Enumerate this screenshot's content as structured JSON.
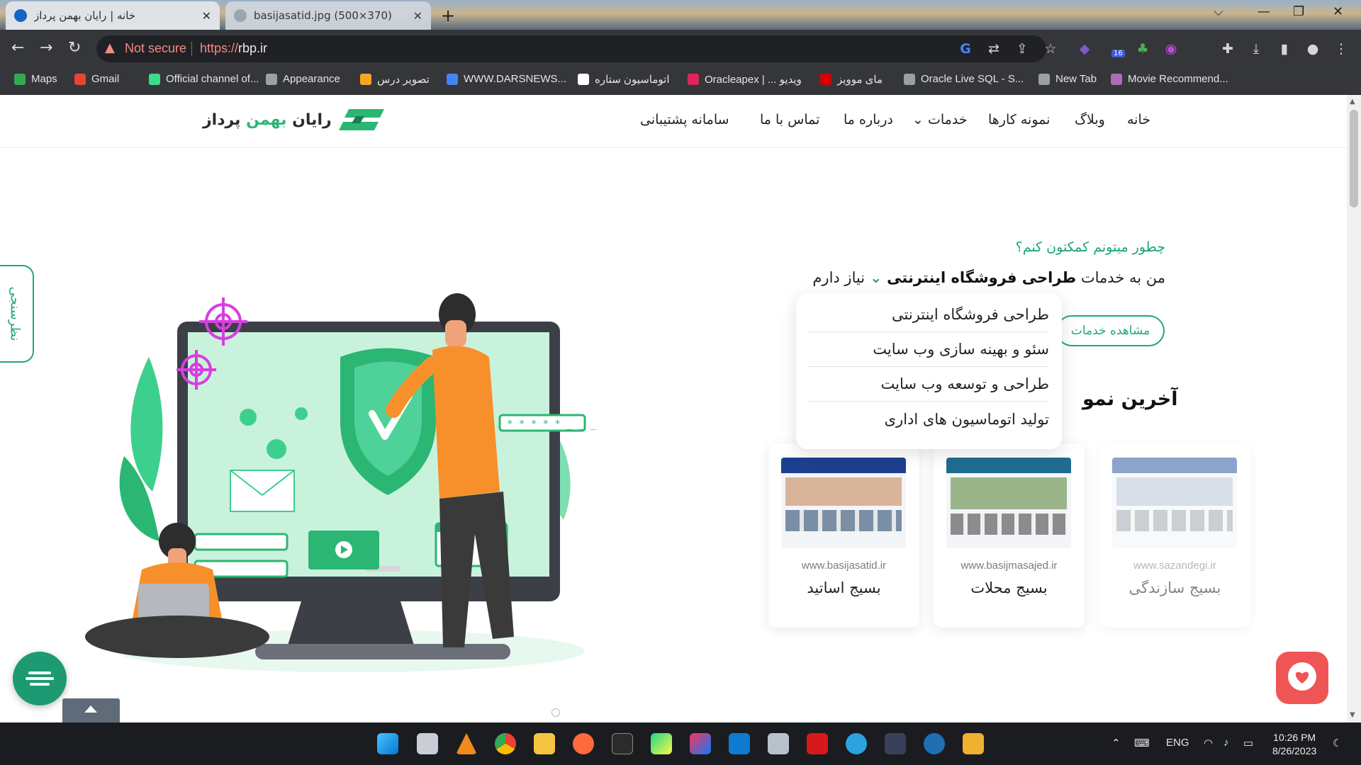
{
  "browser": {
    "tabs": [
      {
        "title": "خانه | رایان بهمن پرداز",
        "active": true
      },
      {
        "title": "basijasatid.jpg (500×370)",
        "active": false
      }
    ],
    "new_tab": "+",
    "window_controls": {
      "chevron": "⌵",
      "minimize": "—",
      "restore": "❐",
      "close": "✕"
    },
    "nav": {
      "back": "←",
      "forward": "→",
      "reload": "↻"
    },
    "address": {
      "warning": "Not secure",
      "scheme": "https://",
      "host": "rbp.ir"
    },
    "toolbar_icons": [
      "google-icon",
      "translate-icon",
      "share-icon",
      "star-icon",
      "extension-icon",
      "download-icon",
      "sidepanel-icon",
      "profile-icon",
      "menu-icon"
    ],
    "extension_badge": "16",
    "bookmarks": [
      {
        "label": "Maps",
        "color": "#34a853"
      },
      {
        "label": "Gmail",
        "color": "#ea4335"
      },
      {
        "label": "Official channel of...",
        "color": "#3ddc84"
      },
      {
        "label": "Appearance",
        "color": "#9aa0a6"
      },
      {
        "label": "تصویر درس",
        "color": "#f6a623"
      },
      {
        "label": "WWW.DARSNEWS...",
        "color": "#4285f4"
      },
      {
        "label": "اتوماسیون ستاره",
        "color": "#ffffff"
      },
      {
        "label": "Oracleapex | ... ویدیو",
        "color": "#e0245e"
      },
      {
        "label": "مای موویز",
        "color": "#d50000"
      },
      {
        "label": "Oracle Live SQL - S...",
        "color": "#9aa0a6"
      },
      {
        "label": "New Tab",
        "color": "#9aa0a6"
      },
      {
        "label": "Movie Recommend...",
        "color": "#b06ab3"
      }
    ]
  },
  "site": {
    "logo": {
      "text_dark": "رایان",
      "text_green": "بهمن",
      "text_dark2": "پرداز"
    },
    "nav": [
      "خانه",
      "وبلاگ",
      "نمونه کارها",
      "خدمات",
      "درباره ما",
      "تماس با ما",
      "سامانه پشتیبانی"
    ],
    "hero": {
      "question": "چطور میتونم کمکتون کنم؟",
      "prefix": "من به خدمات",
      "selected": "طراحی فروشگاه اینترنتی",
      "suffix": "نیاز دارم",
      "cta": "مشاهده خدمات",
      "section_title": "آخرین نمو"
    },
    "dropdown": [
      "طراحی فروشگاه اینترنتی",
      "سئو و بهینه سازی وب سایت",
      "طراحی و توسعه وب سایت",
      "تولید اتوماسیون های اداری"
    ],
    "portfolio": [
      {
        "url": "www.basijasatid.ir",
        "name": "بسیج اساتید"
      },
      {
        "url": "www.basijmasajed.ir",
        "name": "بسیج محلات"
      },
      {
        "url": "www.sazandegi.ir",
        "name": "بسیج سازندگی"
      }
    ],
    "survey": "نظرسنجی",
    "illustration_password": "* * * * *  _ _ _"
  },
  "taskbar": {
    "lang": "ENG",
    "time": "10:26 PM",
    "date": "8/26/2023"
  },
  "colors": {
    "brand_green": "#21a870",
    "chat_red": "#f05555",
    "fab_teal": "#1e9a73",
    "chrome_dark": "#35363a"
  }
}
